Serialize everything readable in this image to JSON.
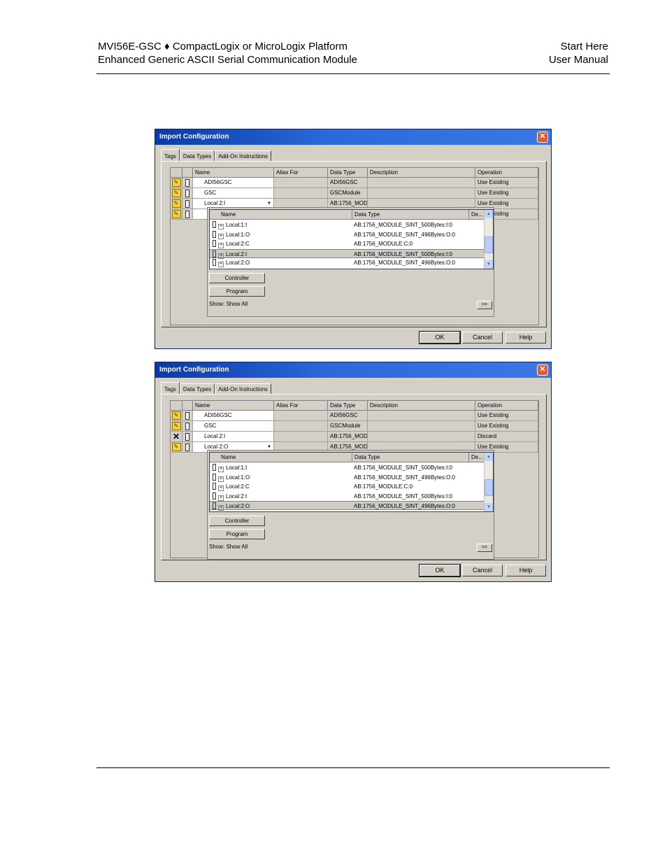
{
  "header": {
    "title_line1": "MVI56E-GSC ♦ CompactLogix or MicroLogix Platform",
    "title_line2": "Enhanced Generic ASCII Serial Communication Module",
    "right_line1": "Start Here",
    "right_line2": "User Manual"
  },
  "dialogs": [
    {
      "title": "Import Configuration",
      "tabs": [
        "Tags",
        "Data Types",
        "Add-On Instructions"
      ],
      "columns": [
        "Name",
        "Alias For",
        "Data Type",
        "Description",
        "Operation"
      ],
      "rows": [
        {
          "icon": "import",
          "name": "ADI56GSC",
          "alias": "",
          "type": "ADI56GSC",
          "desc": "",
          "op": "Use Existing"
        },
        {
          "icon": "import",
          "name": "GSC",
          "alias": "",
          "type": "GSCModule",
          "desc": "",
          "op": "Use Existing"
        },
        {
          "icon": "import",
          "name": "Local 2:I",
          "alias": "",
          "type": "AB:1756_MOD",
          "desc": "",
          "op": "Use Existing"
        },
        {
          "icon": "import",
          "name": "",
          "alias": "",
          "type": "",
          "desc": "",
          "op": "Use Existing"
        }
      ],
      "popup": {
        "columns": [
          "Name",
          "Data Type",
          "De..."
        ],
        "rows": [
          {
            "name": "Local:1:I",
            "type": "AB:1756_MODULE_SINT_500Bytes:I:0"
          },
          {
            "name": "Local:1:O",
            "type": "AB:1756_MODULE_SINT_496Bytes:O:0"
          },
          {
            "name": "Local:2:C",
            "type": "AB:1756_MODULE:C:0"
          },
          {
            "name": "Local:2:I",
            "type": "AB:1756_MODULE_SINT_500Bytes:I:0"
          },
          {
            "name": "Local:2:O",
            "type": "AB:1756_MODULE_SINT_496Bytes:O:0"
          }
        ],
        "controller_label": "Controller",
        "program_label": "Program",
        "show_label": "Show: Show All",
        "more_label": ">>"
      },
      "buttons": {
        "ok": "OK",
        "cancel": "Cancel",
        "help": "Help"
      }
    },
    {
      "title": "Import Configuration",
      "tabs": [
        "Tags",
        "Data Types",
        "Add-On Instructions"
      ],
      "columns": [
        "Name",
        "Alias For",
        "Data Type",
        "Description",
        "Operation"
      ],
      "rows": [
        {
          "icon": "import",
          "name": "ADI56GSC",
          "alias": "",
          "type": "ADI56GSC",
          "desc": "",
          "op": "Use Existing"
        },
        {
          "icon": "import",
          "name": "GSC",
          "alias": "",
          "type": "GSCModule",
          "desc": "",
          "op": "Use Existing"
        },
        {
          "icon": "discard",
          "name": "Local 2:I",
          "alias": "",
          "type": "AB:1756_MOD",
          "desc": "",
          "op": "Discard"
        },
        {
          "icon": "import",
          "name": "Local 2:O",
          "alias": "",
          "type": "AB:1756_MOD",
          "desc": "",
          "op": "Use Existing"
        }
      ],
      "popup": {
        "columns": [
          "Name",
          "Data Type",
          "De..."
        ],
        "rows": [
          {
            "name": "Local:1:I",
            "type": "AB:1756_MODULE_SINT_500Bytes:I:0"
          },
          {
            "name": "Local:1:O",
            "type": "AB:1756_MODULE_SINT_496Bytes:O:0"
          },
          {
            "name": "Local:2:C",
            "type": "AB:1756_MODULE:C:0"
          },
          {
            "name": "Local:2:I",
            "type": "AB:1756_MODULE_SINT_500Bytes:I:0"
          },
          {
            "name": "Local:2:O",
            "type": "AB:1756_MODULE_SINT_496Bytes:O:0"
          }
        ],
        "controller_label": "Controller",
        "program_label": "Program",
        "show_label": "Show: Show All",
        "more_label": ">>"
      },
      "buttons": {
        "ok": "OK",
        "cancel": "Cancel",
        "help": "Help"
      }
    }
  ]
}
